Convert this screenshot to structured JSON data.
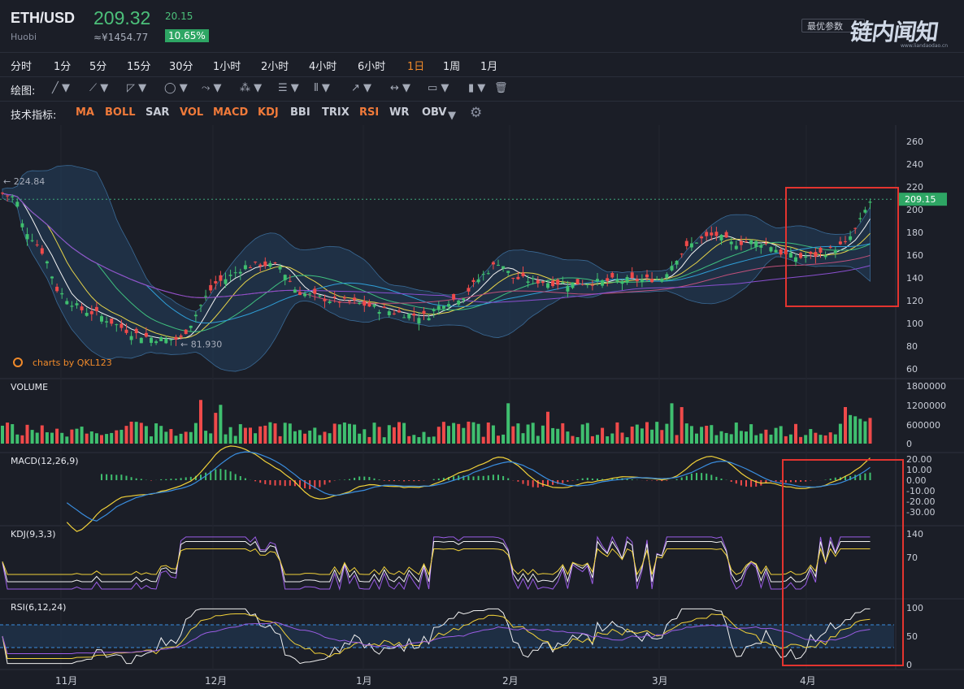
{
  "header": {
    "pair": "ETH/USD",
    "exchange": "Huobi",
    "price": "209.32",
    "cny_price": "≈¥1454.77",
    "change": "20.15",
    "change_pct": "10.65%",
    "params_label": "最优参数",
    "watermark": "链内闻知"
  },
  "timeframes": [
    "分时",
    "1分",
    "5分",
    "15分",
    "30分",
    "1小时",
    "2小时",
    "4小时",
    "6小时",
    "1日",
    "1周",
    "1月"
  ],
  "active_timeframe": "1日",
  "drawing": {
    "label": "绘图:",
    "tools": [
      "line-tool-icon",
      "pen-tool-icon",
      "angle-tool-icon",
      "shape-tool-icon",
      "wave-tool-icon",
      "pattern-tool-icon",
      "fib-tool-icon",
      "channel-tool-icon",
      "arrow-tool-icon",
      "measure-tool-icon",
      "text-tool-icon",
      "position-tool-icon",
      "trash-icon"
    ]
  },
  "indicators": {
    "label": "技术指标:",
    "items": [
      {
        "name": "MA",
        "on": true
      },
      {
        "name": "BOLL",
        "on": true
      },
      {
        "name": "SAR",
        "on": false
      },
      {
        "name": "VOL",
        "on": true
      },
      {
        "name": "MACD",
        "on": true
      },
      {
        "name": "KDJ",
        "on": true
      },
      {
        "name": "BBI",
        "on": false
      },
      {
        "name": "TRIX",
        "on": false
      },
      {
        "name": "RSI",
        "on": true
      },
      {
        "name": "WR",
        "on": false
      },
      {
        "name": "OBV",
        "on": false
      }
    ],
    "active_color": "#f07a3a",
    "inactive_color": "#c8ccd6"
  },
  "panes": {
    "main": {
      "y_ticks": [
        "260",
        "240",
        "220",
        "200",
        "180",
        "160",
        "140",
        "120",
        "100",
        "80",
        "60"
      ],
      "high_label": "224.84",
      "low_label": "81.930",
      "last_price_tag": "209.15",
      "credit": "charts by QKL123"
    },
    "volume": {
      "title": "VOLUME",
      "y_ticks": [
        "1800000",
        "1200000",
        "600000",
        "0"
      ]
    },
    "macd": {
      "title": "MACD(12,26,9)",
      "y_ticks": [
        "20.00",
        "10.00",
        "0.00",
        "-10.00",
        "-20.00",
        "-30.00"
      ]
    },
    "kdj": {
      "title": "KDJ(9,3,3)",
      "y_ticks": [
        "140",
        "70"
      ]
    },
    "rsi": {
      "title": "RSI(6,12,24)",
      "y_ticks": [
        "100",
        "50",
        "0"
      ]
    }
  },
  "x_labels": [
    "11月",
    "12月",
    "1月",
    "2月",
    "3月",
    "4月"
  ],
  "colors": {
    "up": "#3fbf6f",
    "down": "#ef4a4a",
    "accent": "#f08a2a",
    "highlight": "#e3342f"
  }
}
